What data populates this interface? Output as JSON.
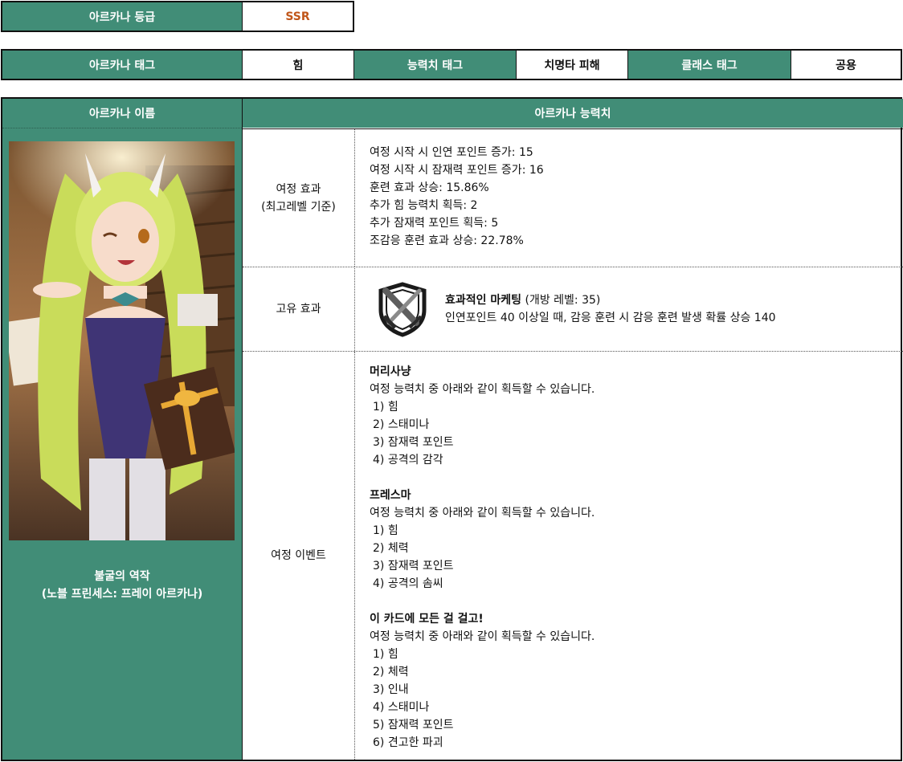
{
  "grade": {
    "label": "아르카나 등급",
    "value": "SSR"
  },
  "tags": {
    "arcana_tag_label": "아르카나 태그",
    "arcana_tag_value": "힘",
    "stat_tag_label": "능력치 태그",
    "stat_tag_value": "치명타 피해",
    "class_tag_label": "클래스 태그",
    "class_tag_value": "공용"
  },
  "name_col": {
    "header": "아르카나 이름",
    "name_line1": "불굴의 역작",
    "name_line2": "(노블 프린세스: 프레이 아르카나)"
  },
  "stats_col": {
    "header": "아르카나 능력치"
  },
  "journey_effect": {
    "label_line1": "여정 효과",
    "label_line2": "(최고레벨 기준)",
    "lines": [
      "여정 시작 시 인연 포인트 증가: 15",
      "여정 시작 시 잠재력 포인트 증가: 16",
      "훈련 효과 상승: 15.86%",
      "추가 힘 능력치 획득: 2",
      "추가 잠재력 포인트 획득: 5",
      "조감응 훈련 효과 상승: 22.78%"
    ]
  },
  "unique_effect": {
    "label": "고유 효과",
    "icon": "crossed-swords-shield-icon",
    "skill_name": "효과적인 마케팅",
    "skill_level": "(개방 레벨: 35)",
    "description": "인연포인트 40 이상일 때, 감응 훈련 시 감응 훈련 발생 확률 상승 140"
  },
  "journey_event": {
    "label": "여정 이벤트",
    "events": [
      {
        "title": "머리사냥",
        "desc": "여정 능력치 중 아래와 같이 획득할 수 있습니다.",
        "items": [
          "1) 힘",
          "2) 스태미나",
          "3) 잠재력 포인트",
          "4) 공격의 감각"
        ]
      },
      {
        "title": "프레스마",
        "desc": "여정 능력치 중 아래와 같이 획득할 수 있습니다.",
        "items": [
          "1) 힘",
          "2) 체력",
          "3) 잠재력 포인트",
          "4) 공격의 솜씨"
        ]
      },
      {
        "title": "이 카드에 모든 걸 걸고!",
        "desc": "여정 능력치 중 아래와 같이 획득할 수 있습니다.",
        "items": [
          "1) 힘",
          "2) 체력",
          "3) 인내",
          "4) 스태미나",
          "5) 잠재력 포인트",
          "6) 견고한 파괴"
        ]
      }
    ]
  },
  "colors": {
    "header_green": "#418d77",
    "ssr_orange": "#c0561a"
  }
}
